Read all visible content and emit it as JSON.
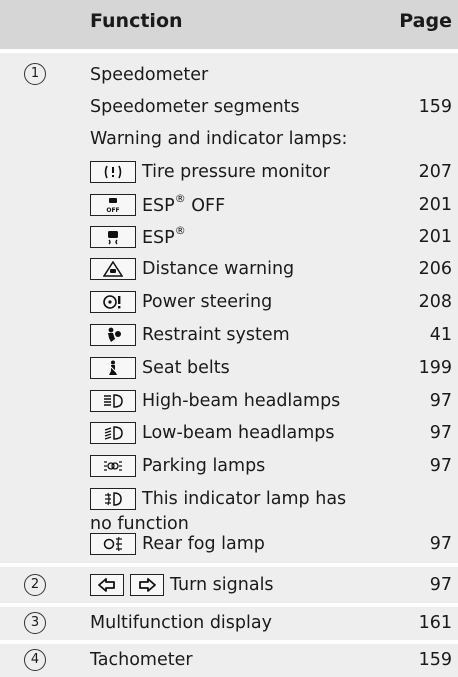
{
  "header": {
    "function": "Function",
    "page": "Page"
  },
  "sections": [
    {
      "number": "1",
      "rows": [
        {
          "label": "Speedometer",
          "page": ""
        },
        {
          "label": "Speedometer segments",
          "page": "159"
        },
        {
          "label": "Warning and indicator lamps:",
          "page": ""
        },
        {
          "icon": "tire-pressure-icon",
          "label": "Tire pressure monitor",
          "page": "207"
        },
        {
          "icon": "esp-off-icon",
          "label": "ESP® OFF",
          "page": "201"
        },
        {
          "icon": "esp-icon",
          "label": "ESP®",
          "page": "201"
        },
        {
          "icon": "distance-warning-icon",
          "label": "Distance warning",
          "page": "206"
        },
        {
          "icon": "power-steering-icon",
          "label": "Power steering",
          "page": "208"
        },
        {
          "icon": "restraint-system-icon",
          "label": "Restraint system",
          "page": "41"
        },
        {
          "icon": "seat-belt-icon",
          "label": "Seat belts",
          "page": "199"
        },
        {
          "icon": "high-beam-icon",
          "label": "High-beam headlamps",
          "page": "97"
        },
        {
          "icon": "low-beam-icon",
          "label": "Low-beam headlamps",
          "page": "97"
        },
        {
          "icon": "parking-lamps-icon",
          "label": "Parking lamps",
          "page": "97"
        },
        {
          "icon": "front-fog-icon",
          "label": "This indicator lamp has",
          "label2": "no function",
          "page": ""
        },
        {
          "icon": "rear-fog-icon",
          "label": "Rear fog lamp",
          "page": "97"
        }
      ]
    },
    {
      "number": "2",
      "label": "Turn signals",
      "page": "97"
    },
    {
      "number": "3",
      "label": "Multifunction display",
      "page": "161"
    },
    {
      "number": "4",
      "label": "Tachometer",
      "page": "159"
    }
  ]
}
